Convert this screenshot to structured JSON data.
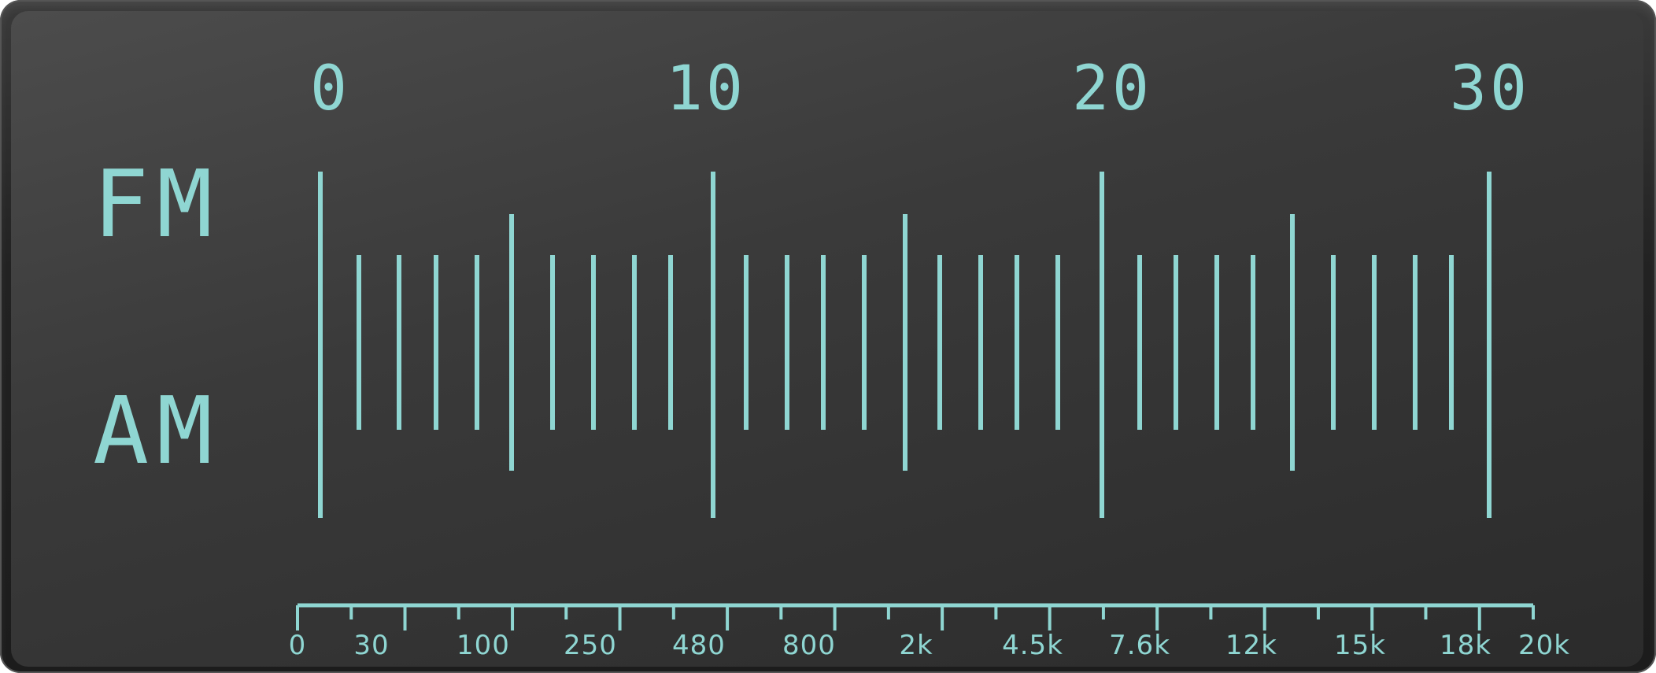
{
  "display": {
    "color": "#8fd6d2",
    "dial_numbers": [
      "0",
      "10",
      "20",
      "30"
    ],
    "bands": {
      "fm": "FM",
      "am": "AM"
    },
    "frequency_labels": [
      "0",
      "30",
      "100",
      "250",
      "480",
      "800",
      "2k",
      "4.5k",
      "7.6k",
      "12k",
      "15k",
      "18k",
      "20k"
    ]
  }
}
